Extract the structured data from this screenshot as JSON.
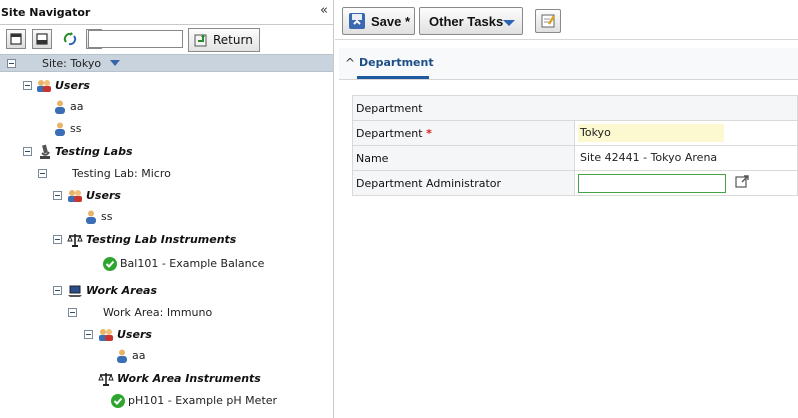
{
  "navigator": {
    "title": "Site Navigator",
    "collapse_glyph": "«",
    "toolbar": {
      "search_value": "",
      "return_label": "Return"
    }
  },
  "tree": {
    "site": "Site: Tokyo",
    "users_label": "Users",
    "user_aa": "aa",
    "user_ss": "ss",
    "testing_labs": "Testing Labs",
    "testing_lab_micro": "Testing Lab: Micro",
    "lab_users": "Users",
    "lab_user_ss": "ss",
    "lab_instruments": "Testing Lab Instruments",
    "instrument_bal": "Bal101 - Example Balance",
    "work_areas": "Work Areas",
    "work_area_immuno": "Work Area: Immuno",
    "wa_users": "Users",
    "wa_user_aa": "aa",
    "wa_instruments": "Work Area Instruments",
    "instrument_ph": "pH101 - Example pH Meter"
  },
  "toolbar": {
    "save_label": "Save *",
    "other_tasks_label": "Other Tasks"
  },
  "section": {
    "tab_label": "Department"
  },
  "form": {
    "header": "Department",
    "department_label": "Department",
    "department_required_mark": "*",
    "department_value": "Tokyo",
    "name_label": "Name",
    "name_value": "Site 42441 - Tokyo Arena",
    "admin_label": "Department Administrator",
    "admin_value": ""
  },
  "colors": {
    "site_row_bg": "#c9d3dd",
    "accent": "#1f5aa0",
    "required": "#d42020",
    "status_ok": "#2ea62e"
  }
}
